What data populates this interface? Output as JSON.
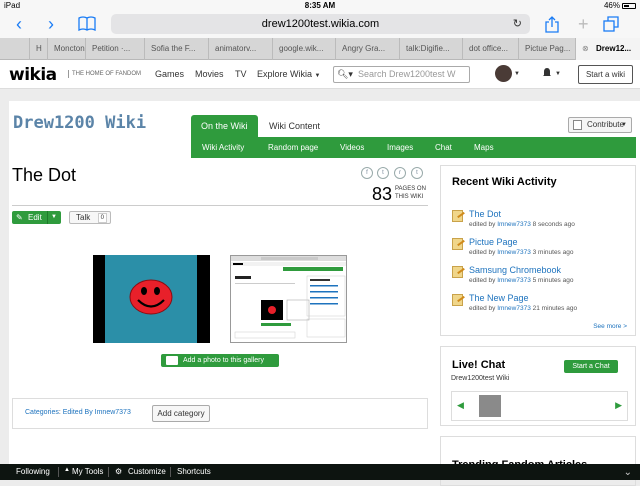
{
  "status": {
    "device": "iPad",
    "time": "8:35 AM",
    "battery": "46%"
  },
  "browser": {
    "url": "drew1200test.wikia.com",
    "tabs": [
      {
        "label": "H"
      },
      {
        "label": "Moncton..."
      },
      {
        "label": "Petition ·..."
      },
      {
        "label": "Sofia the F..."
      },
      {
        "label": "animatorv..."
      },
      {
        "label": "google.wik..."
      },
      {
        "label": "Angry Gra..."
      },
      {
        "label": "talk:Digifie..."
      },
      {
        "label": "dot office..."
      },
      {
        "label": "Pictue Pag..."
      },
      {
        "label": "Drew12..."
      }
    ]
  },
  "wikia": {
    "logo": "wikia",
    "tagline": "THE HOME OF FANDOM",
    "nav": [
      "Games",
      "Movies",
      "TV",
      "Explore Wikia"
    ],
    "search_placeholder": "Search Drew1200test W",
    "start_wiki": "Start a wiki"
  },
  "wiki": {
    "name": "Drew1200 Wiki",
    "tabs": {
      "on_the_wiki": "On the Wiki",
      "wiki_content": "Wiki Content"
    },
    "subnav": [
      "Wiki Activity",
      "Random page",
      "Videos",
      "Images",
      "Chat",
      "Maps"
    ],
    "contribute": "Contribute"
  },
  "article": {
    "title": "The Dot",
    "page_count": "83",
    "page_count_label_1": "PAGES ON",
    "page_count_label_2": "THIS WIKI",
    "edit": "Edit",
    "talk": "Talk",
    "talk_count": "0",
    "add_photo": "Add a photo to this gallery",
    "categories_label": "Categories",
    "category": "Edited By Imnew7373",
    "add_category": "Add category"
  },
  "share_icons": [
    "f",
    "t",
    "r",
    "t"
  ],
  "activity": {
    "title": "Recent Wiki Activity",
    "items": [
      {
        "title": "The Dot",
        "by": "edited by",
        "user": "Imnew7373",
        "time": "8 seconds ago"
      },
      {
        "title": "Pictue Page",
        "by": "edited by",
        "user": "Imnew7373",
        "time": "3 minutes ago"
      },
      {
        "title": "Samsung Chromebook",
        "by": "edited by",
        "user": "Imnew7373",
        "time": "5 minutes ago"
      },
      {
        "title": "The New Page",
        "by": "edited by",
        "user": "Imnew7373",
        "time": "21 minutes ago"
      }
    ],
    "see_more": "See more >"
  },
  "livechat": {
    "title": "Live! Chat",
    "start": "Start a Chat",
    "wiki": "Drew1200test Wiki"
  },
  "trending": {
    "title": "Trending Fandom Articles"
  },
  "bottom": {
    "following": "Following",
    "mytools": "My Tools",
    "customize": "Customize",
    "shortcuts": "Shortcuts"
  }
}
